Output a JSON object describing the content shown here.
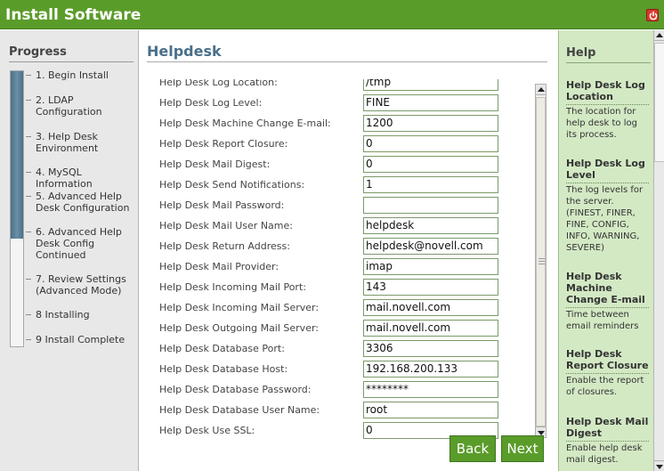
{
  "window": {
    "title": "Install Software",
    "accent_color": "#5a9c2a"
  },
  "progress": {
    "heading": "Progress",
    "completed_fraction": 0.61,
    "steps": [
      {
        "label": "1. Begin Install"
      },
      {
        "label": "2. LDAP Configuration"
      },
      {
        "label": "3. Help Desk Environment"
      },
      {
        "label": "4. MySQL Information"
      },
      {
        "label": "5. Advanced Help Desk Configuration"
      },
      {
        "label": "6. Advanced Help Desk Config Continued"
      },
      {
        "label": "7. Review Settings (Advanced Mode)"
      },
      {
        "label": "8 Installing"
      },
      {
        "label": "9 Install Complete"
      }
    ]
  },
  "main": {
    "heading": "Helpdesk",
    "fields": [
      {
        "label": "Help Desk Log Location:",
        "value": "/tmp"
      },
      {
        "label": "Help Desk Log Level:",
        "value": "FINE"
      },
      {
        "label": "Help Desk Machine Change E-mail:",
        "value": "1200"
      },
      {
        "label": "Help Desk Report Closure:",
        "value": "0"
      },
      {
        "label": "Help Desk Mail Digest:",
        "value": "0"
      },
      {
        "label": "Help Desk Send Notifications:",
        "value": "1"
      },
      {
        "label": "Help Desk Mail Password:",
        "value": ""
      },
      {
        "label": "Help Desk Mail User Name:",
        "value": "helpdesk"
      },
      {
        "label": "Help Desk Return Address:",
        "value": "helpdesk@novell.com"
      },
      {
        "label": "Help Desk Mail Provider:",
        "value": "imap"
      },
      {
        "label": "Help Desk Incoming Mail Port:",
        "value": "143"
      },
      {
        "label": "Help Desk Incoming Mail Server:",
        "value": "mail.novell.com"
      },
      {
        "label": "Help Desk Outgoing Mail Server:",
        "value": "mail.novell.com"
      },
      {
        "label": "Help Desk Database Port:",
        "value": "3306"
      },
      {
        "label": "Help Desk Database Host:",
        "value": "192.168.200.133"
      },
      {
        "label": "Help Desk Database Password:",
        "value": "********"
      },
      {
        "label": "Help Desk Database User Name:",
        "value": "root"
      },
      {
        "label": "Help Desk Use SSL:",
        "value": "0"
      }
    ],
    "back_label": "Back",
    "next_label": "Next"
  },
  "help": {
    "heading": "Help",
    "items": [
      {
        "title": "Help Desk Log Location",
        "desc": "The location for help desk to log its process."
      },
      {
        "title": "Help Desk Log Level",
        "desc": "The log levels for the server. (FINEST, FINER, FINE, CONFIG, INFO, WARNING, SEVERE)"
      },
      {
        "title": "Help Desk Machine Change E-mail",
        "desc": "Time between email reminders"
      },
      {
        "title": "Help Desk Report Closure",
        "desc": "Enable the report of closures."
      },
      {
        "title": "Help Desk Mail Digest",
        "desc": "Enable help desk mail digest."
      }
    ]
  }
}
